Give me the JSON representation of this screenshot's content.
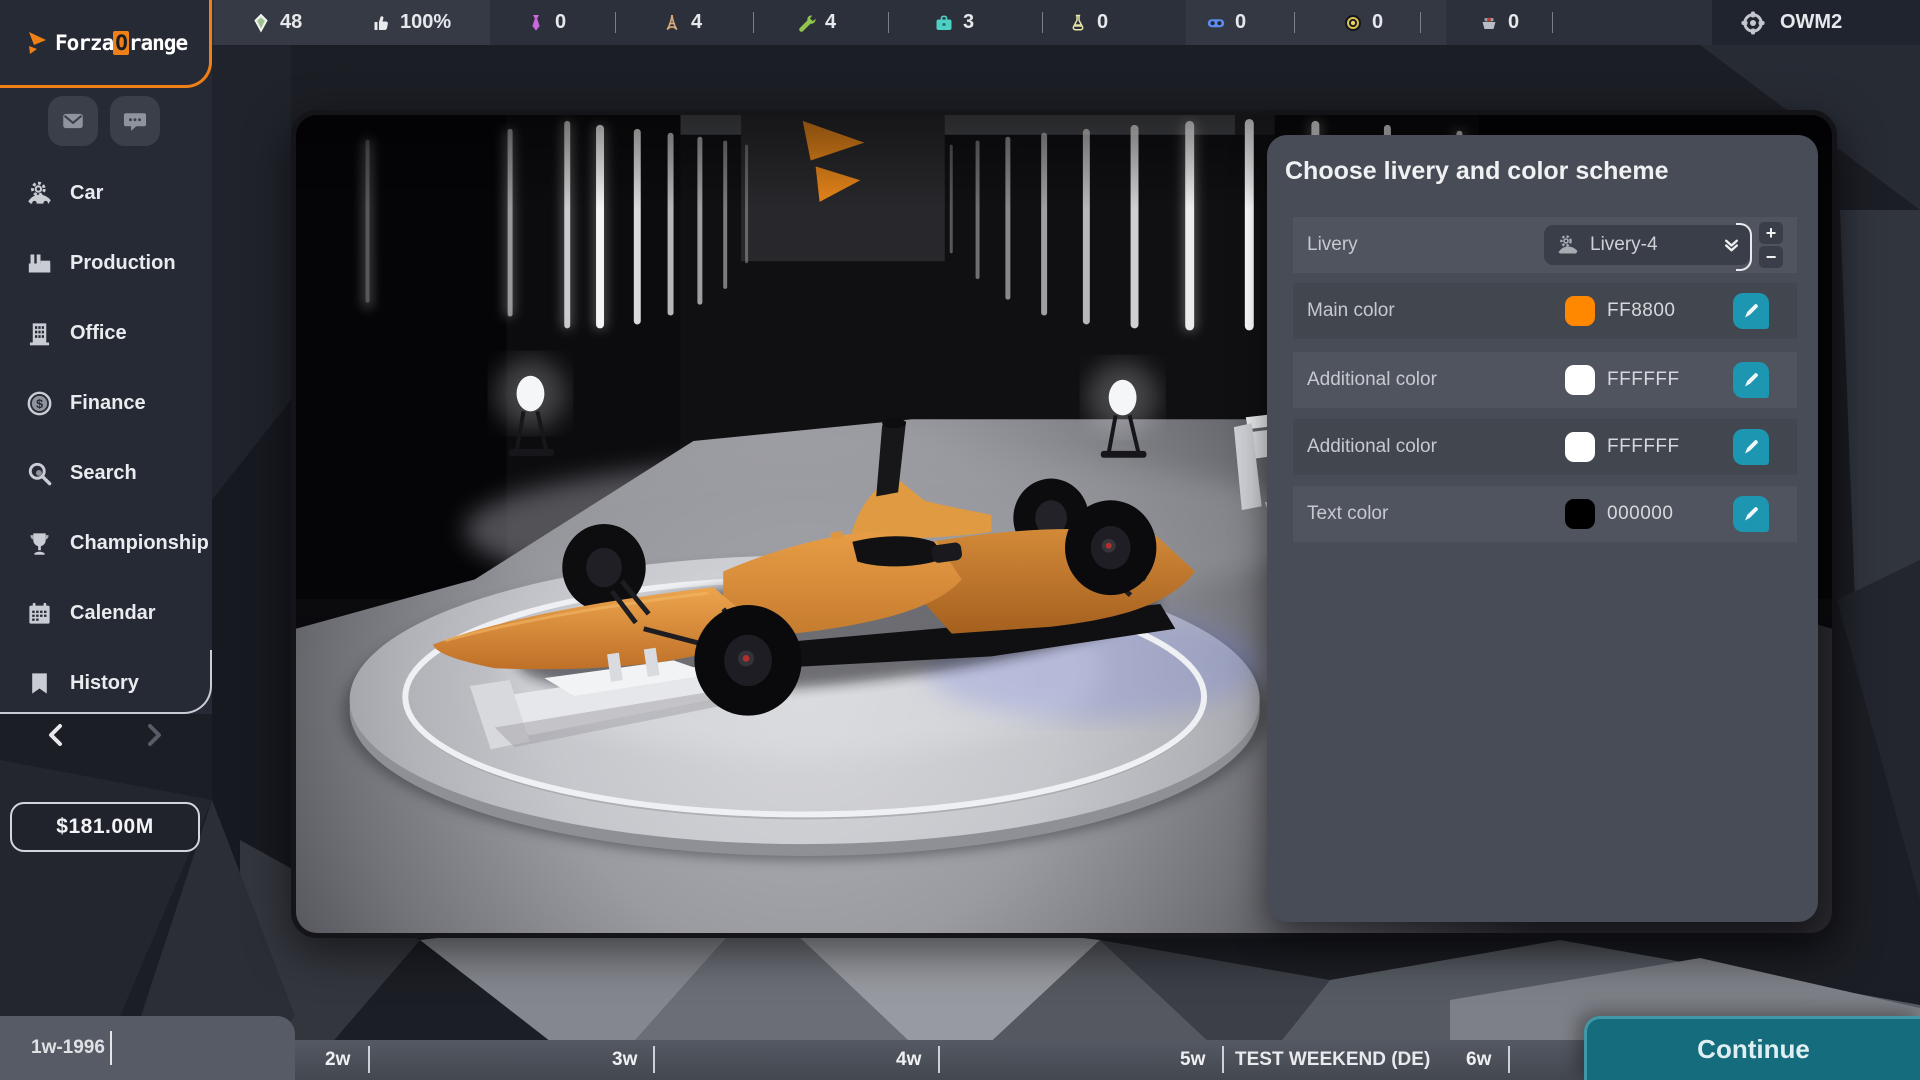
{
  "top_bar": {
    "stats": [
      {
        "icon": "gem-icon",
        "value": "48"
      },
      {
        "icon": "thumbs-up-icon",
        "value": "100%"
      },
      {
        "icon": "tie-icon",
        "value": "0"
      },
      {
        "icon": "tower-icon",
        "value": "4"
      },
      {
        "icon": "wrench-icon",
        "value": "4"
      },
      {
        "icon": "briefcase-icon",
        "value": "3"
      },
      {
        "icon": "flask-icon",
        "value": "0"
      },
      {
        "icon": "goggles-icon",
        "value": "0"
      },
      {
        "icon": "tire-icon",
        "value": "0"
      },
      {
        "icon": "engine-icon",
        "value": "0"
      }
    ],
    "user": {
      "icon": "steering-wheel-icon",
      "name": "OWM2"
    }
  },
  "sidebar": {
    "logo": {
      "icon": "orange-arrow-icon",
      "part1": "Forza",
      "accent": "O",
      "part2": "range"
    },
    "message_buttons": [
      {
        "icon": "mail-icon"
      },
      {
        "icon": "chat-icon"
      }
    ],
    "items": [
      {
        "icon": "car-icon",
        "label": "Car"
      },
      {
        "icon": "factory-icon",
        "label": "Production"
      },
      {
        "icon": "office-icon",
        "label": "Office"
      },
      {
        "icon": "finance-icon",
        "label": "Finance"
      },
      {
        "icon": "search-icon",
        "label": "Search"
      },
      {
        "icon": "trophy-icon",
        "label": "Championship"
      },
      {
        "icon": "calendar-icon",
        "label": "Calendar"
      },
      {
        "icon": "history-icon",
        "label": "History"
      }
    ],
    "budget": "$181.00M"
  },
  "livery_panel": {
    "title": "Choose livery and color scheme",
    "livery_row": {
      "label": "Livery",
      "value": "Livery-4",
      "increase": "+",
      "decrease": "−"
    },
    "color_rows": [
      {
        "label": "Main color",
        "hex": "FF8800",
        "color": "#FF8800"
      },
      {
        "label": "Additional color",
        "hex": "FFFFFF",
        "color": "#FFFFFF"
      },
      {
        "label": "Additional color",
        "hex": "FFFFFF",
        "color": "#FFFFFF"
      },
      {
        "label": "Text color",
        "hex": "000000",
        "color": "#000000"
      }
    ]
  },
  "timeline": {
    "current": "1w-1996",
    "weeks": [
      {
        "label": "2w"
      },
      {
        "label": "3w"
      },
      {
        "label": "4w"
      },
      {
        "label": "5w",
        "event": "TEST WEEKEND (DE)"
      },
      {
        "label": "6w"
      }
    ],
    "continue_label": "Continue"
  },
  "colors": {
    "accent_orange": "#FF8800",
    "teal_button": "#1D96B2",
    "panel_bg": "#484C56"
  }
}
